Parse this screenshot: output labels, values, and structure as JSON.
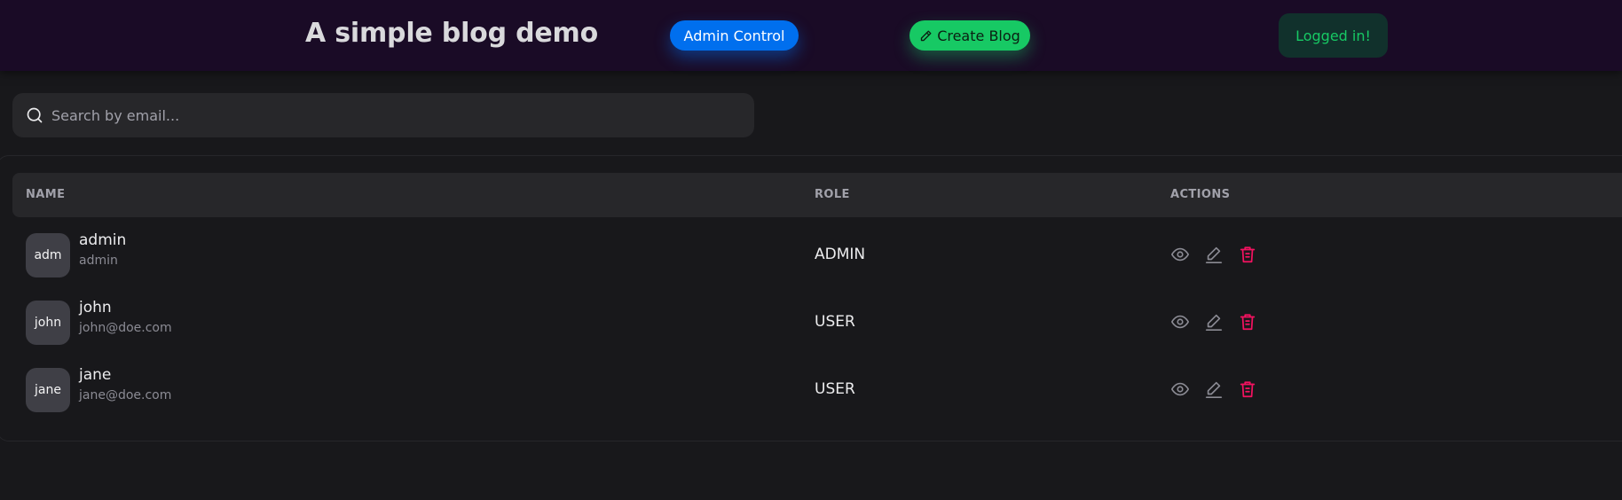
{
  "header": {
    "title": "A simple blog demo",
    "admin_button": "Admin Control",
    "create_button": "Create Blog",
    "status_badge": "Logged in!"
  },
  "search": {
    "placeholder": "Search by email...",
    "value": "",
    "icon": "search-icon"
  },
  "table": {
    "columns": [
      "NAME",
      "ROLE",
      "ACTIONS"
    ],
    "rows": [
      {
        "avatar": "adm",
        "name": "admin",
        "email": "admin",
        "role": "ADMIN"
      },
      {
        "avatar": "john",
        "name": "john",
        "email": "john@doe.com",
        "role": "USER"
      },
      {
        "avatar": "jane",
        "name": "jane",
        "email": "jane@doe.com",
        "role": "USER"
      }
    ],
    "action_icons": [
      "eye-icon",
      "pencil-icon",
      "trash-icon"
    ]
  },
  "colors": {
    "header_bg": "#1a0b26",
    "primary": "#006fee",
    "success": "#17c964",
    "danger": "#f31260",
    "page_bg": "#18181b"
  }
}
